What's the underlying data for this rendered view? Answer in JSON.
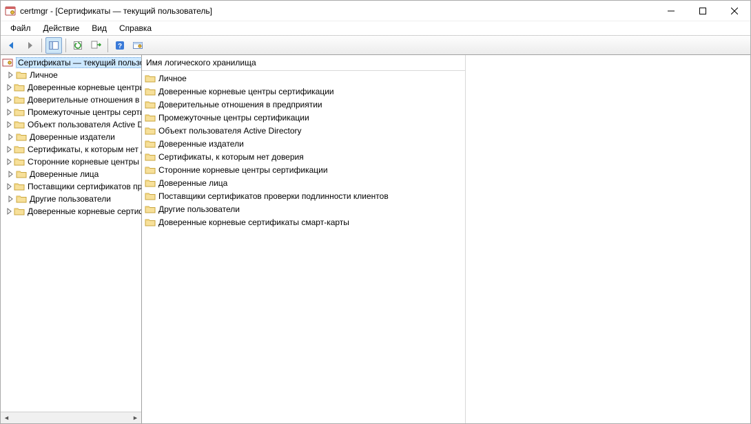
{
  "window": {
    "title": "certmgr - [Сертификаты — текущий пользователь]"
  },
  "menubar": {
    "file": "Файл",
    "action": "Действие",
    "view": "Вид",
    "help": "Справка"
  },
  "tree": {
    "root": "Сертификаты — текущий пользователь",
    "items": [
      "Личное",
      "Доверенные корневые центры сертификации",
      "Доверительные отношения в предприятии",
      "Промежуточные центры сертификации",
      "Объект пользователя Active Directory",
      "Доверенные издатели",
      "Сертификаты, к которым нет доверия",
      "Сторонние корневые центры сертификации",
      "Доверенные лица",
      "Поставщики сертификатов проверки подлинности клиентов",
      "Другие пользователи",
      "Доверенные корневые сертификаты смарт-карты"
    ]
  },
  "list": {
    "column_header": "Имя логического хранилища",
    "items": [
      "Личное",
      "Доверенные корневые центры сертификации",
      "Доверительные отношения в предприятии",
      "Промежуточные центры сертификации",
      "Объект пользователя Active Directory",
      "Доверенные издатели",
      "Сертификаты, к которым нет доверия",
      "Сторонние корневые центры сертификации",
      "Доверенные лица",
      "Поставщики сертификатов проверки подлинности клиентов",
      "Другие пользователи",
      "Доверенные корневые сертификаты смарт-карты"
    ]
  }
}
